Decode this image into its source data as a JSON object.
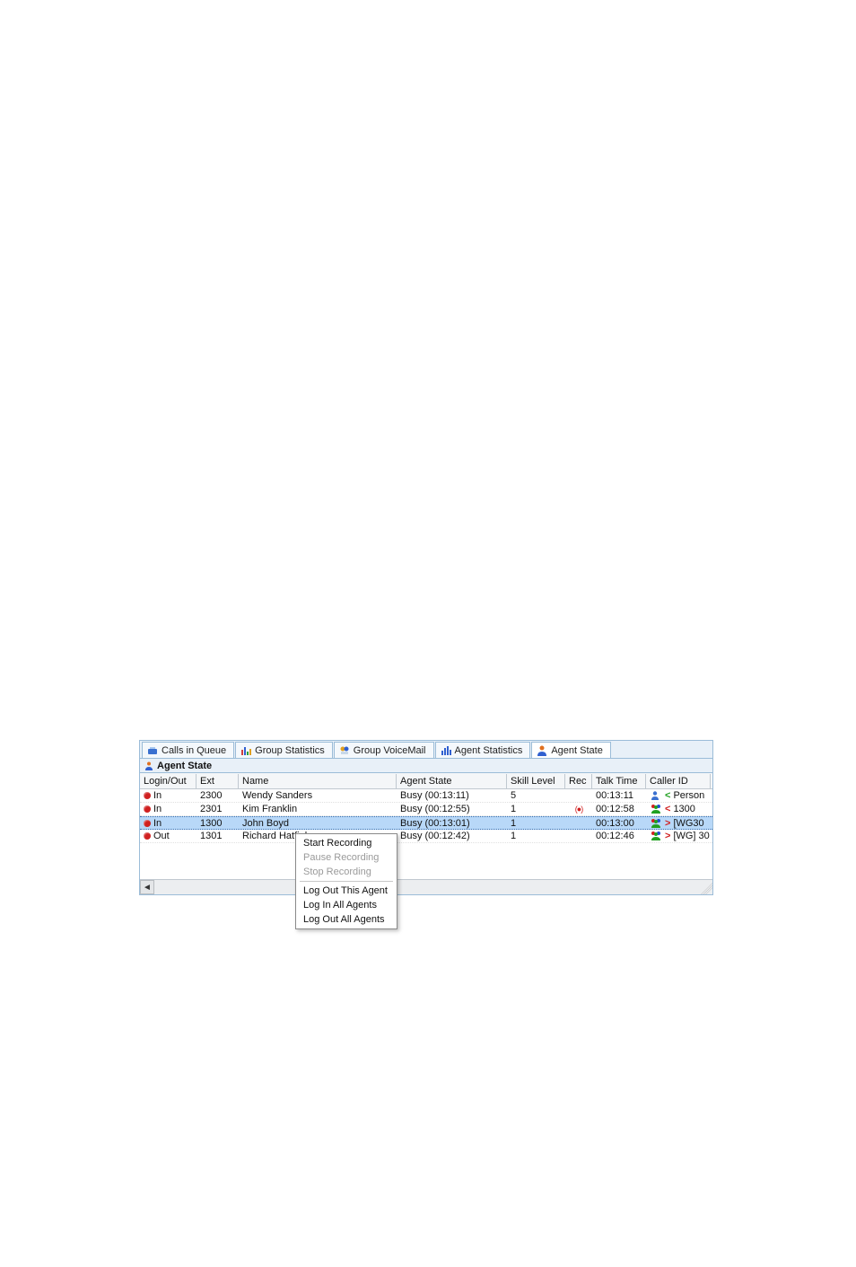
{
  "tabs": [
    {
      "label": "Calls in Queue"
    },
    {
      "label": "Group Statistics"
    },
    {
      "label": "Group VoiceMail"
    },
    {
      "label": "Agent Statistics"
    },
    {
      "label": "Agent State"
    }
  ],
  "subheader": {
    "label": "Agent State"
  },
  "columns": {
    "login": "Login/Out",
    "ext": "Ext",
    "name": "Name",
    "state": "Agent State",
    "skill": "Skill Level",
    "rec": "Rec",
    "talk": "Talk Time",
    "cid": "Caller ID"
  },
  "rows": [
    {
      "login": "In",
      "ext": "2300",
      "name": "Wendy Sanders",
      "state": "Busy (00:13:11)",
      "skill": "5",
      "rec": "",
      "talk": "00:13:11",
      "cid": "Person",
      "cid_icon": "person-blue",
      "arrow": "<",
      "arrow_color": "green"
    },
    {
      "login": "In",
      "ext": "2301",
      "name": "Kim Franklin",
      "state": "Busy (00:12:55)",
      "skill": "1",
      "rec": "(●)",
      "talk": "00:12:58",
      "cid": "1300",
      "cid_icon": "person-multi",
      "arrow": "<",
      "arrow_color": "red"
    },
    {
      "login": "In",
      "ext": "1300",
      "name": "John Boyd",
      "state": "Busy (00:13:01)",
      "skill": "1",
      "rec": "",
      "talk": "00:13:00",
      "cid": "[WG30",
      "cid_icon": "person-multi",
      "arrow": ">",
      "arrow_color": "red",
      "selected": true
    },
    {
      "login": "Out",
      "ext": "1301",
      "name": "Richard Hatfiel",
      "state": "Busy (00:12:42)",
      "skill": "1",
      "rec": "",
      "talk": "00:12:46",
      "cid": "[WG] 30",
      "cid_icon": "person-multi",
      "arrow": ">",
      "arrow_color": "red"
    }
  ],
  "context_menu": {
    "start_recording": "Start Recording",
    "pause_recording": "Pause Recording",
    "stop_recording": "Stop Recording",
    "logout_this": "Log Out This Agent",
    "login_all": "Log In All Agents",
    "logout_all": "Log Out All Agents"
  }
}
